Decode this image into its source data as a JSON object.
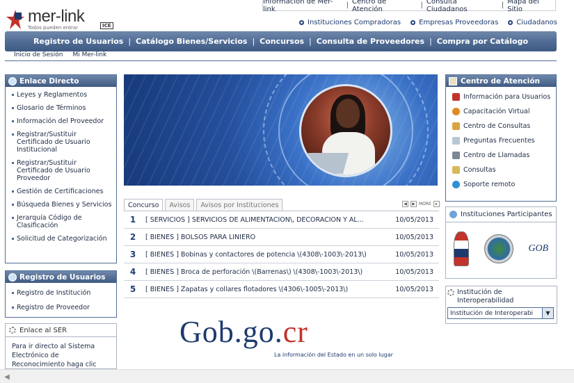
{
  "toplinks": [
    "Información de Mer-link",
    "Centro de Atención",
    "Consulta Ciudadanos",
    "Mapa del Sitio"
  ],
  "logo": {
    "name": "mer-link",
    "tagline": "Todos pueden entrar",
    "badge": "ICE"
  },
  "secondary_links": [
    "Instituciones Compradoras",
    "Empresas Proveedoras",
    "Ciudadanos"
  ],
  "main_nav": [
    "Registro de Usuarios",
    "Catálogo Bienes/Servicios",
    "Concursos",
    "Consulta de Proveedores",
    "Compra por Catálogo"
  ],
  "sub_nav": [
    "Inicio de Sesión",
    "Mi Mer-link"
  ],
  "enlace_directo": {
    "title": "Enlace Directo",
    "items": [
      "Leyes y Reglamentos",
      "Glosario de Términos",
      "Información del Proveedor",
      "Registrar/Sustituir Certificado de Usuario Institucional",
      "Registrar/Sustituir Certificado de Usuario Proveedor",
      "Gestión de Certificaciones",
      "Búsqueda Bienes y Servicios",
      "Jerarquía Código de Clasificación",
      "Solicitud de Categorización"
    ]
  },
  "registro_usuarios": {
    "title": "Registro de Usuarios",
    "items": [
      "Registro de Institución",
      "Registro de Proveedor"
    ]
  },
  "enlace_ser": {
    "title": "Enlace al SER",
    "text": "Para ir directo al Sistema Electrónico de Reconocimiento haga clic"
  },
  "tabs": [
    "Concurso",
    "Avisos",
    "Avisos por Instituciones"
  ],
  "pager_more": "MORE",
  "concursos": [
    {
      "num": "1",
      "desc": "[ SERVICIOS ] SERVICIOS DE ALIMENTACIÓN\\, DECORACIÓN Y AL...",
      "date": "10/05/2013"
    },
    {
      "num": "2",
      "desc": "[ BIENES ] BOLSOS PARA LINIERO",
      "date": "10/05/2013"
    },
    {
      "num": "3",
      "desc": "[ BIENES ] Bobinas y contactores de potencia \\(4308\\-1003\\-2013\\)",
      "date": "10/05/2013"
    },
    {
      "num": "4",
      "desc": "[ BIENES ] Broca de perforación \\(Barrenas\\) \\(4308\\-1003\\-2013\\)",
      "date": "10/05/2013"
    },
    {
      "num": "5",
      "desc": "[ BIENES ] Zapatas y collares flotadores \\(4306\\-1005\\-2013\\)",
      "date": "10/05/2013"
    }
  ],
  "gob": {
    "part1": "Gob.go.",
    "part2": "cr",
    "caption": "La información del Estado en un solo lugar"
  },
  "centro_atencion": {
    "title": "Centro de Atención",
    "items": [
      "Información para Usuarios",
      "Capacitación Virtual",
      "Centro de Consultas",
      "Preguntas Frecuentes",
      "Centro de Llamadas",
      "Consultas",
      "Soporte remoto"
    ]
  },
  "instituciones_participantes": {
    "title": "Instituciones Participantes",
    "gov_logo": "GOB"
  },
  "interoperabilidad": {
    "label": "Institución de Interoperabilidad",
    "selected": "Institución de Interoperabi"
  },
  "colors": {
    "nav_blue": "#4f6b94",
    "text": "#1d2a44",
    "red": "#c3322b"
  }
}
